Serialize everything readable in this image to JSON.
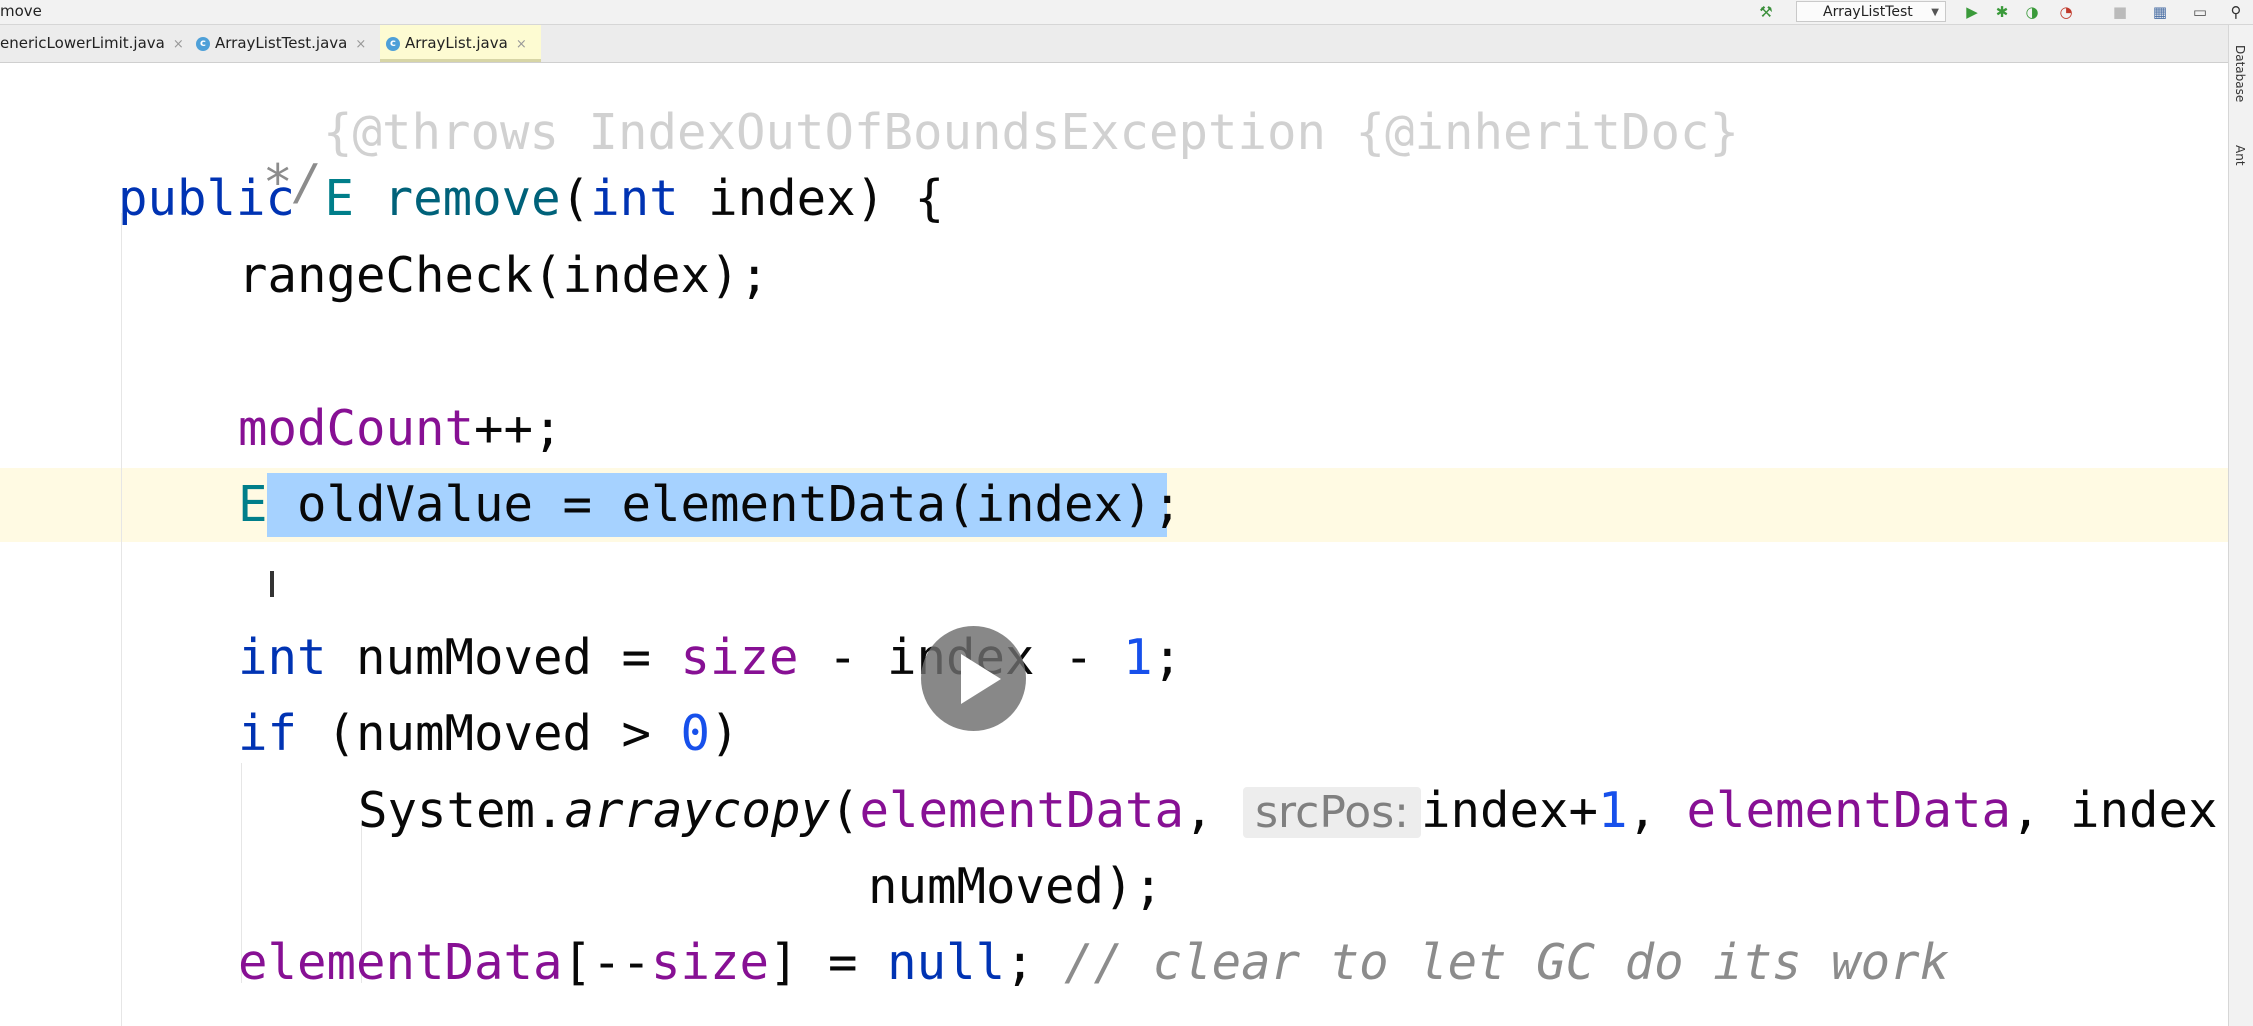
{
  "toolbar": {
    "path": "move",
    "run_config": "ArrayListTest",
    "icons": [
      "hammer-icon",
      "run-icon",
      "debug-icon",
      "coverage-icon",
      "profile-icon",
      "stop-icon",
      "project-structure-icon",
      "window-icon",
      "search-icon"
    ]
  },
  "tabs": [
    {
      "label": "enericLowerLimit.java",
      "active": false
    },
    {
      "label": "ArrayListTest.java",
      "active": false
    },
    {
      "label": "ArrayList.java",
      "active": true
    }
  ],
  "tab_close": "×",
  "side_panels": [
    "Database",
    "Ant"
  ],
  "code": {
    "l0": "{@throws IndexOutOfBoundsException {@inheritDoc}",
    "l1": "*/",
    "l2": {
      "kw1": "public",
      "sp1": " ",
      "type": "E",
      "sp2": " ",
      "name": "remove",
      "p1": "(",
      "kw2": "int",
      "rest": " index) {"
    },
    "l3": "rangeCheck(index);",
    "l5": {
      "fld": "modCount",
      "rest": "++;"
    },
    "l6": {
      "type": "E",
      "sel": " oldValue = elementData(index)",
      "rest": ";"
    },
    "l8": {
      "kw": "int",
      "a": " numMoved = ",
      "fld": "size",
      "b": " - index - ",
      "num": "1",
      "c": ";"
    },
    "l9": {
      "kw": "if",
      "a": " (numMoved > ",
      "num": "0",
      "b": ")"
    },
    "l10": {
      "a": "System.",
      "method": "arraycopy",
      "b": "(",
      "fld1": "elementData",
      "c": ", ",
      "hint": "srcPos:",
      "d": "index+",
      "num": "1",
      "e": ", ",
      "fld2": "elementData",
      "f": ", index"
    },
    "l11": "numMoved);",
    "l12": {
      "fld1": "elementData",
      "a": "[--",
      "fld2": "size",
      "b": "] = ",
      "kw": "null",
      "c": "; ",
      "cmt": "// clear to let GC do its work"
    }
  },
  "colors": {
    "keyword": "#0033b3",
    "field": "#871094",
    "number": "#1750eb",
    "comment": "#8c8c8c",
    "selection": "#a6d2ff",
    "current_line": "#fffae3"
  }
}
